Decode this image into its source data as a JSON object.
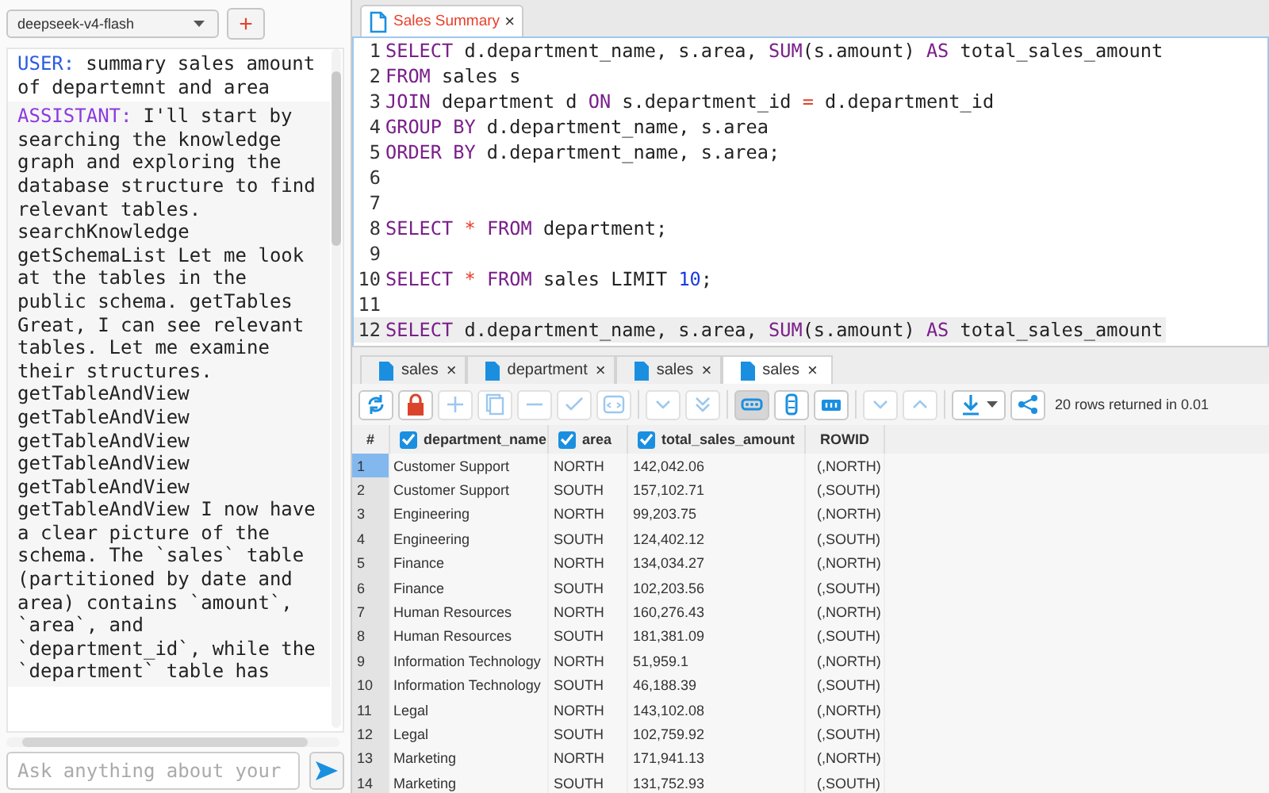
{
  "chat": {
    "model": "deepseek-v4-flash",
    "add_button": "+",
    "messages": [
      {
        "kind": "user",
        "label": "USER:",
        "text": "summary sales amount of departemnt and area"
      },
      {
        "kind": "assistant",
        "label": "ASSISTANT:",
        "text": "I'll start by searching the knowledge graph and exploring the database structure to find relevant tables. searchKnowledge getSchemaList Let me look at the tables in the public schema. getTables Great, I can see relevant tables. Let me examine their structures. getTableAndView getTableAndView getTableAndView getTableAndView getTableAndView getTableAndView I now have a clear picture of the schema. The `sales` table (partitioned by date and area) contains `amount`, `area`, and `department_id`, while the `department` table has"
      }
    ],
    "input": {
      "placeholder": "Ask anything about your"
    }
  },
  "editor": {
    "tabs": [
      {
        "label": "Sales Summary",
        "selected": true,
        "close": "×"
      }
    ],
    "lines": [
      {
        "number": "1",
        "tokens": [
          {
            "kind": "kw",
            "text": "SELECT"
          },
          {
            "kind": "plain",
            "text": " d.department_name, s.area, "
          },
          {
            "kind": "kw",
            "text": "SUM"
          },
          {
            "kind": "plain",
            "text": "(s.amount) "
          },
          {
            "kind": "kw",
            "text": "AS"
          },
          {
            "kind": "plain",
            "text": " total_sales_amount"
          }
        ]
      },
      {
        "number": "2",
        "tokens": [
          {
            "kind": "kw",
            "text": "FROM"
          },
          {
            "kind": "plain",
            "text": " sales s"
          }
        ]
      },
      {
        "number": "3",
        "tokens": [
          {
            "kind": "kw",
            "text": "JOIN"
          },
          {
            "kind": "plain",
            "text": " department d "
          },
          {
            "kind": "kw",
            "text": "ON"
          },
          {
            "kind": "plain",
            "text": " s.department_id "
          },
          {
            "kind": "op",
            "text": "="
          },
          {
            "kind": "plain",
            "text": " d.department_id"
          }
        ]
      },
      {
        "number": "4",
        "tokens": [
          {
            "kind": "kw",
            "text": "GROUP BY"
          },
          {
            "kind": "plain",
            "text": " d.department_name, s.area"
          }
        ]
      },
      {
        "number": "5",
        "tokens": [
          {
            "kind": "kw",
            "text": "ORDER BY"
          },
          {
            "kind": "plain",
            "text": " d.department_name, s.area;"
          }
        ]
      },
      {
        "number": "6"
      },
      {
        "number": "7"
      },
      {
        "number": "8",
        "tokens": [
          {
            "kind": "kw",
            "text": "SELECT"
          },
          {
            "kind": "op",
            "text": " * "
          },
          {
            "kind": "kw",
            "text": "FROM"
          },
          {
            "kind": "plain",
            "text": " department;"
          }
        ]
      },
      {
        "number": "9"
      },
      {
        "number": "10",
        "tokens": [
          {
            "kind": "kw",
            "text": "SELECT"
          },
          {
            "kind": "op",
            "text": " * "
          },
          {
            "kind": "kw",
            "text": "FROM"
          },
          {
            "kind": "plain",
            "text": " sales LIMIT "
          },
          {
            "kind": "num",
            "text": "10"
          },
          {
            "kind": "plain",
            "text": ";"
          }
        ]
      },
      {
        "number": "11"
      },
      {
        "number": "12",
        "current": true,
        "tokens": [
          {
            "kind": "kw",
            "text": "SELECT"
          },
          {
            "kind": "plain",
            "text": " d.department_name, s.area, "
          },
          {
            "kind": "kw",
            "text": "SUM"
          },
          {
            "kind": "plain",
            "text": "(s.amount) "
          },
          {
            "kind": "kw",
            "text": "AS"
          },
          {
            "kind": "plain",
            "text": " total_sales_amount"
          }
        ]
      }
    ]
  },
  "results": {
    "tabs": [
      {
        "label": "sales",
        "selected": false,
        "close": "×"
      },
      {
        "label": "department",
        "selected": false,
        "close": "×"
      },
      {
        "label": "sales",
        "selected": false,
        "close": "×"
      },
      {
        "label": "sales",
        "selected": true,
        "close": "×"
      }
    ],
    "toolbar": [
      {
        "kind": "refresh",
        "disabled": false
      },
      {
        "kind": "lock",
        "disabled": false
      },
      {
        "kind": "plus",
        "disabled": true
      },
      {
        "kind": "copy",
        "disabled": true
      },
      {
        "kind": "minus",
        "disabled": true
      },
      {
        "kind": "check",
        "disabled": true
      },
      {
        "kind": "code",
        "disabled": true
      },
      {
        "kind": "sep"
      },
      {
        "kind": "down",
        "disabled": true
      },
      {
        "kind": "double-down",
        "disabled": true
      },
      {
        "kind": "sep"
      },
      {
        "kind": "grid",
        "disabled": false,
        "selected": true
      },
      {
        "kind": "record",
        "disabled": false,
        "selected": false
      },
      {
        "kind": "text",
        "disabled": false,
        "selected": false
      },
      {
        "kind": "sep"
      },
      {
        "kind": "down",
        "disabled": true
      },
      {
        "kind": "up",
        "disabled": true
      },
      {
        "kind": "sep"
      },
      {
        "kind": "export",
        "disabled": false
      },
      {
        "kind": "share",
        "disabled": false
      }
    ],
    "status": "20 rows returned in 0.01",
    "columns": [
      {
        "label": "#"
      },
      {
        "label": "department_name",
        "checked": true
      },
      {
        "label": "area",
        "checked": true
      },
      {
        "label": "total_sales_amount",
        "checked": true
      },
      {
        "label": "ROWID"
      }
    ],
    "rows": [
      {
        "selected": true,
        "cells": [
          "1",
          "Customer Support",
          "NORTH",
          "142,042.06",
          "(,NORTH)"
        ]
      },
      {
        "selected": false,
        "cells": [
          "2",
          "Customer Support",
          "SOUTH",
          "157,102.71",
          "(,SOUTH)"
        ]
      },
      {
        "selected": false,
        "cells": [
          "3",
          "Engineering",
          "NORTH",
          "99,203.75",
          "(,NORTH)"
        ]
      },
      {
        "selected": false,
        "cells": [
          "4",
          "Engineering",
          "SOUTH",
          "124,402.12",
          "(,SOUTH)"
        ]
      },
      {
        "selected": false,
        "cells": [
          "5",
          "Finance",
          "NORTH",
          "134,034.27",
          "(,NORTH)"
        ]
      },
      {
        "selected": false,
        "cells": [
          "6",
          "Finance",
          "SOUTH",
          "102,203.56",
          "(,SOUTH)"
        ]
      },
      {
        "selected": false,
        "cells": [
          "7",
          "Human Resources",
          "NORTH",
          "160,276.43",
          "(,NORTH)"
        ]
      },
      {
        "selected": false,
        "cells": [
          "8",
          "Human Resources",
          "SOUTH",
          "181,381.09",
          "(,SOUTH)"
        ]
      },
      {
        "selected": false,
        "cells": [
          "9",
          "Information Technology",
          "NORTH",
          "51,959.1",
          "(,NORTH)"
        ]
      },
      {
        "selected": false,
        "cells": [
          "10",
          "Information Technology",
          "SOUTH",
          "46,188.39",
          "(,SOUTH)"
        ]
      },
      {
        "selected": false,
        "cells": [
          "11",
          "Legal",
          "NORTH",
          "143,102.08",
          "(,NORTH)"
        ]
      },
      {
        "selected": false,
        "cells": [
          "12",
          "Legal",
          "SOUTH",
          "102,759.92",
          "(,SOUTH)"
        ]
      },
      {
        "selected": false,
        "cells": [
          "13",
          "Marketing",
          "NORTH",
          "171,941.13",
          "(,NORTH)"
        ]
      },
      {
        "selected": false,
        "cells": [
          "14",
          "Marketing",
          "SOUTH",
          "131,752.93",
          "(,SOUTH)"
        ]
      }
    ]
  }
}
